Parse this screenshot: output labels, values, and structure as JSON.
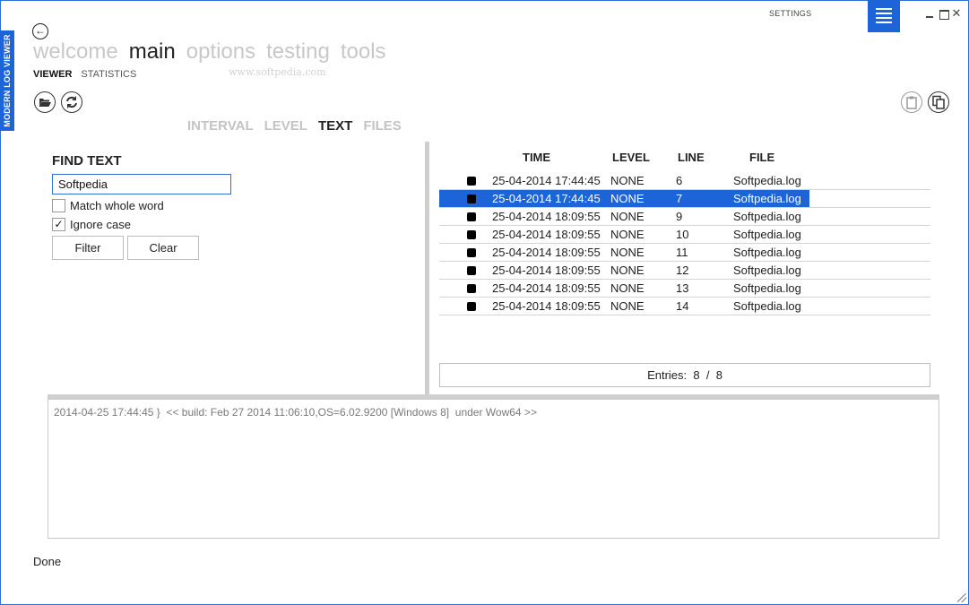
{
  "app": {
    "side_title": "MODERN LOG VIEWER",
    "settings_label": "SETTINGS",
    "close_glyph": "✕",
    "back_glyph": "←"
  },
  "nav": {
    "items": [
      "welcome",
      "main",
      "options",
      "testing",
      "tools"
    ],
    "active": "main"
  },
  "watermark": "www.softpedia.com",
  "subnav": {
    "items": [
      "VIEWER",
      "STATISTICS"
    ],
    "active": "VIEWER"
  },
  "toolbar": {
    "left_icons": [
      "open-folder-icon",
      "refresh-icon"
    ],
    "right_icons": [
      "clipboard-icon",
      "copy-icon"
    ]
  },
  "filter_tabs": {
    "items": [
      "INTERVAL",
      "LEVEL",
      "TEXT",
      "FILES"
    ],
    "active": "TEXT"
  },
  "find": {
    "title": "FIND TEXT",
    "value": "Softpedia",
    "match_whole_word": {
      "label": "Match whole word",
      "checked": false
    },
    "ignore_case": {
      "label": "Ignore case",
      "checked": true,
      "glyph": "✓"
    },
    "filter_label": "Filter",
    "clear_label": "Clear"
  },
  "grid": {
    "columns": {
      "time": "TIME",
      "level": "LEVEL",
      "line": "LINE",
      "file": "FILE"
    },
    "rows": [
      {
        "time": "25-04-2014 17:44:45",
        "level": "NONE",
        "line": "6",
        "file": "Softpedia.log",
        "selected": false
      },
      {
        "time": "25-04-2014 17:44:45",
        "level": "NONE",
        "line": "7",
        "file": "Softpedia.log",
        "selected": true
      },
      {
        "time": "25-04-2014 18:09:55",
        "level": "NONE",
        "line": "9",
        "file": "Softpedia.log",
        "selected": false
      },
      {
        "time": "25-04-2014 18:09:55",
        "level": "NONE",
        "line": "10",
        "file": "Softpedia.log",
        "selected": false
      },
      {
        "time": "25-04-2014 18:09:55",
        "level": "NONE",
        "line": "11",
        "file": "Softpedia.log",
        "selected": false
      },
      {
        "time": "25-04-2014 18:09:55",
        "level": "NONE",
        "line": "12",
        "file": "Softpedia.log",
        "selected": false
      },
      {
        "time": "25-04-2014 18:09:55",
        "level": "NONE",
        "line": "13",
        "file": "Softpedia.log",
        "selected": false
      },
      {
        "time": "25-04-2014 18:09:55",
        "level": "NONE",
        "line": "14",
        "file": "Softpedia.log",
        "selected": false
      }
    ],
    "entries_label": "Entries:",
    "entries_shown": "8",
    "entries_sep": "/",
    "entries_total": "8"
  },
  "detail": {
    "text": "2014-04-25 17:44:45 }  << build: Feb 27 2014 11:06:10,OS=6.02.9200 [Windows 8]  under Wow64 >>"
  },
  "status": "Done",
  "colors": {
    "accent": "#1c64d8",
    "divider": "#cfcfcf",
    "inactive_text": "#c4c4c4"
  }
}
